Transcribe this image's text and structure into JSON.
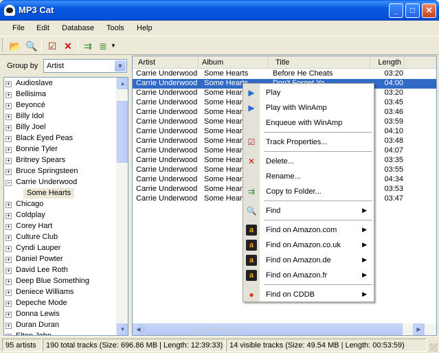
{
  "window": {
    "title": "MP3 Cat"
  },
  "menu": [
    "File",
    "Edit",
    "Database",
    "Tools",
    "Help"
  ],
  "toolbar": {
    "icons": [
      "open-folder-icon",
      "search-icon",
      "properties-icon",
      "delete-icon",
      "copy-to-folder-icon",
      "enqueue-icon"
    ]
  },
  "groupby": {
    "label": "Group by",
    "value": "Artist"
  },
  "tree": {
    "artists_before": [
      "Audioslave",
      "Bellisima",
      "Beyoncé",
      "Billy Idol",
      "Billy Joel",
      "Black Eyed Peas",
      "Bonnie Tyler",
      "Britney Spears",
      "Bruce Springsteen"
    ],
    "expanded_artist": "Carrie Underwood",
    "selected_album": "Some Hearts",
    "artists_after": [
      "Chicago",
      "Coldplay",
      "Corey Hart",
      "Culture Club",
      "Cyndi Lauper",
      "Daniel Powter",
      "David Lee Roth",
      "Deep Blue Something",
      "Deniece Williams",
      "Depeche Mode",
      "Donna Lewis",
      "Duran Duran",
      "Elton John"
    ]
  },
  "tracks": {
    "headers": [
      "Artist",
      "Album",
      "Title",
      "Length"
    ],
    "rows": [
      [
        "Carrie Underwood",
        "Some Hearts",
        "Before He Cheats",
        "03:20"
      ],
      [
        "Carrie Underwood",
        "Some Hearts",
        "Don't Forget Yo",
        "04:00"
      ],
      [
        "Carrie Underwood",
        "Some Hearts",
        "",
        "03:20"
      ],
      [
        "Carrie Underwood",
        "Some Hearts",
        "",
        "03:45"
      ],
      [
        "Carrie Underwood",
        "Some Hearts",
        "",
        "03:46"
      ],
      [
        "Carrie Underwood",
        "Some Hearts",
        "",
        "03:59"
      ],
      [
        "Carrie Underwood",
        "Some Hearts",
        "",
        "04:10"
      ],
      [
        "Carrie Underwood",
        "Some Hearts",
        "",
        "03:48"
      ],
      [
        "Carrie Underwood",
        "Some Hearts",
        "",
        "04:07"
      ],
      [
        "Carrie Underwood",
        "Some Hearts",
        "",
        "03:35"
      ],
      [
        "Carrie Underwood",
        "Some Hearts",
        "",
        "03:55"
      ],
      [
        "Carrie Underwood",
        "Some Hearts",
        "",
        "04:34"
      ],
      [
        "Carrie Underwood",
        "Some Hearts",
        "",
        "03:53"
      ],
      [
        "Carrie Underwood",
        "Some Hearts",
        "",
        "03:47"
      ]
    ],
    "selected_index": 1
  },
  "context_menu": [
    {
      "label": "Play",
      "icon": "play-icon",
      "submenu": false
    },
    {
      "label": "Play with WinAmp",
      "icon": "play-winamp-icon",
      "submenu": false
    },
    {
      "label": "Enqueue with WinAmp",
      "icon": "",
      "submenu": false,
      "sep_after": true
    },
    {
      "label": "Track Properties...",
      "icon": "properties-icon",
      "submenu": false,
      "sep_after": true
    },
    {
      "label": "Delete...",
      "icon": "delete-icon",
      "submenu": false
    },
    {
      "label": "Rename...",
      "icon": "",
      "submenu": false
    },
    {
      "label": "Copy to Folder...",
      "icon": "copy-to-folder-icon",
      "submenu": false,
      "sep_after": true
    },
    {
      "label": "Find",
      "icon": "search-icon",
      "submenu": true,
      "sep_after": true
    },
    {
      "label": "Find on Amazon.com",
      "icon": "amazon-icon",
      "submenu": true
    },
    {
      "label": "Find on Amazon.co.uk",
      "icon": "amazon-icon",
      "submenu": true
    },
    {
      "label": "Find on Amazon.de",
      "icon": "amazon-icon",
      "submenu": true
    },
    {
      "label": "Find on Amazon.fr",
      "icon": "amazon-icon",
      "submenu": true,
      "sep_after": true
    },
    {
      "label": "Find on CDDB",
      "icon": "cddb-icon",
      "submenu": true
    }
  ],
  "watermark": "snapfiles.com",
  "status": {
    "artists": "95 artists",
    "total": "190 total tracks (Size: 696.86 MB | Length: 12:39:33)",
    "visible": "14 visible tracks (Size: 49.54 MB | Length: 00:53:59)"
  },
  "colors": {
    "selection": "#316AC5",
    "titlebar": "#0A5FE8",
    "amazon_accent": "#F7A521"
  }
}
